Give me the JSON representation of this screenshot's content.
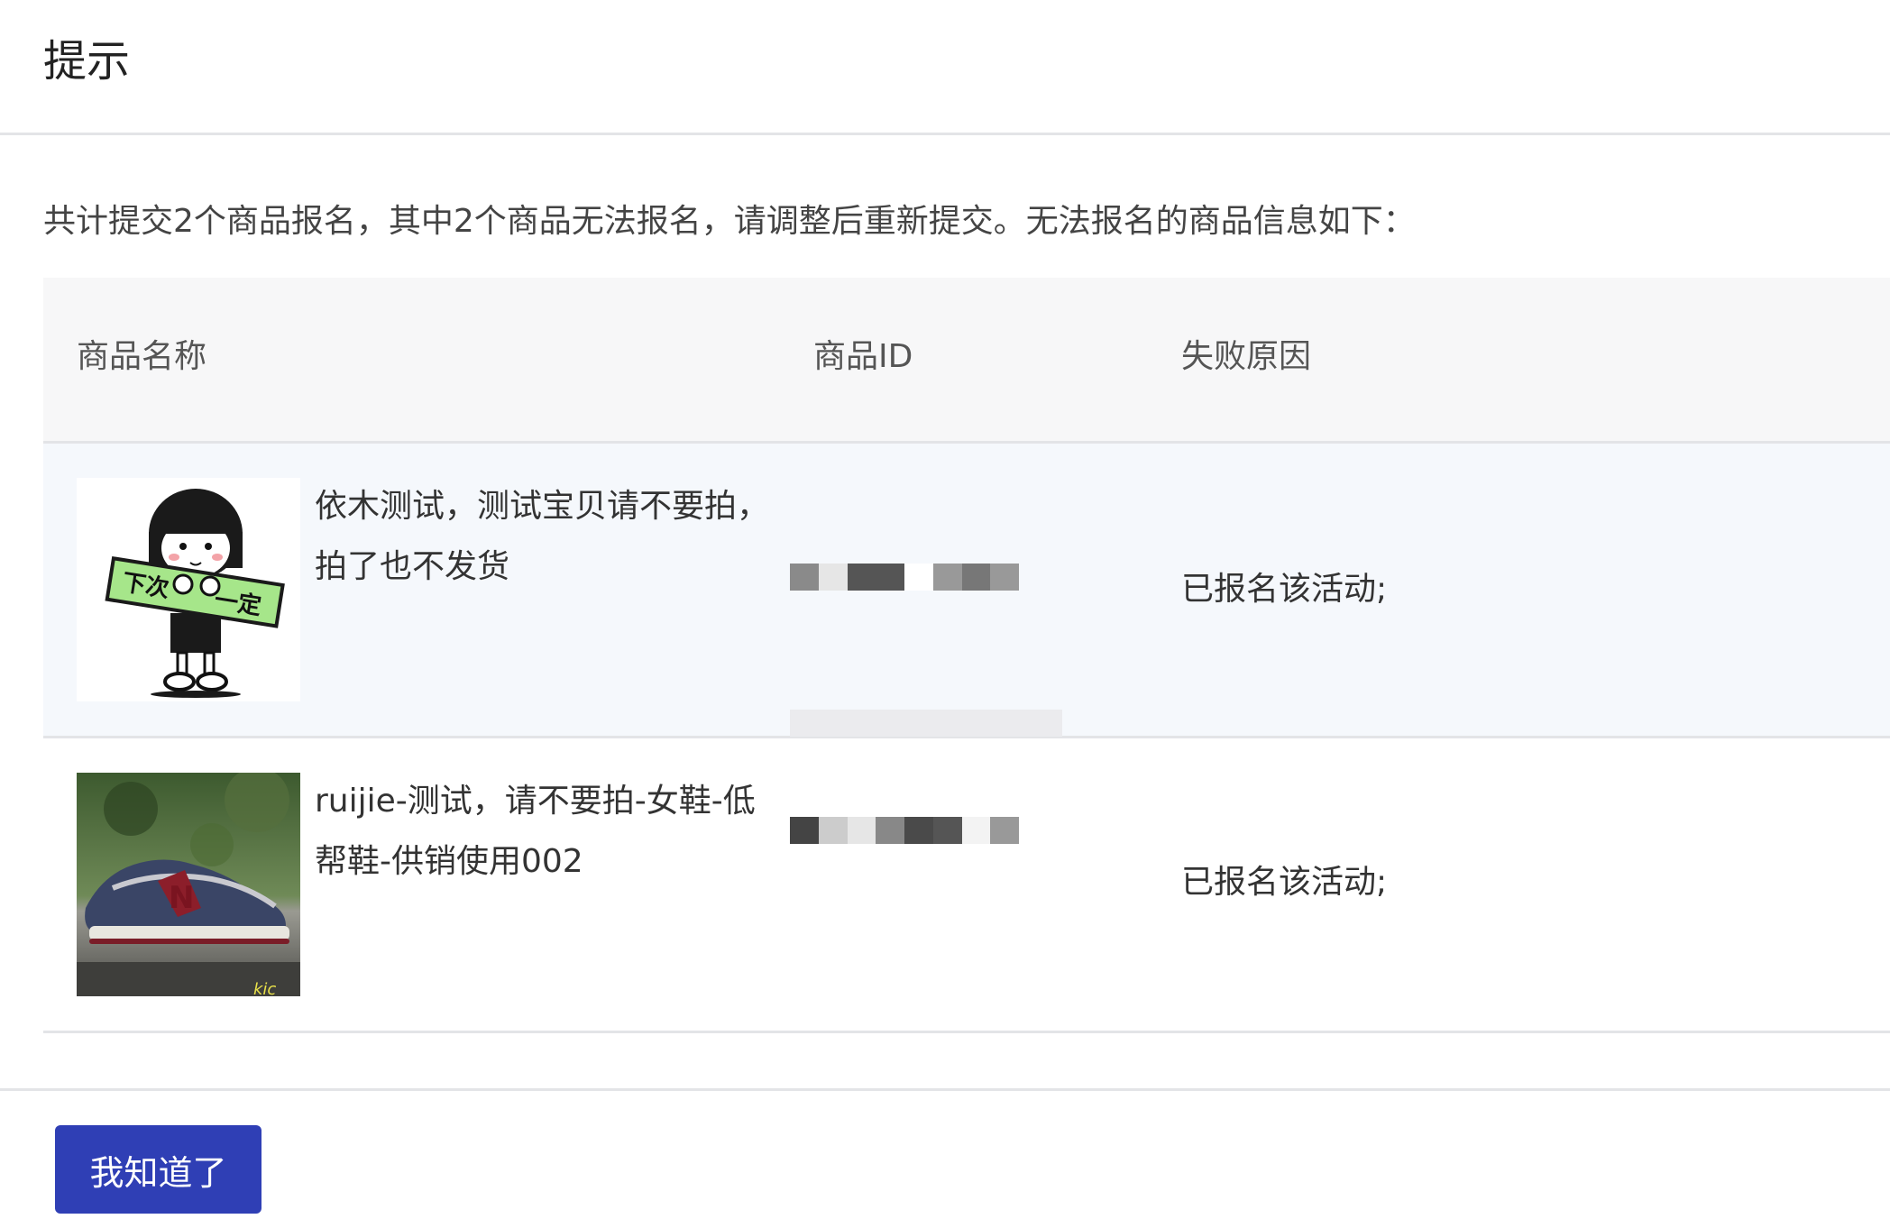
{
  "dialog": {
    "title": "提示",
    "summary": "共计提交2个商品报名，其中2个商品无法报名，请调整后重新提交。无法报名的商品信息如下："
  },
  "table": {
    "columns": [
      "商品名称",
      "商品ID",
      "失败原因"
    ],
    "rows": [
      {
        "name": "依木测试，测试宝贝请不要拍，拍了也不发货",
        "product_id": "",
        "reason": "已报名该活动;",
        "thumbnail_icon": "cartoon-girl-sign-image",
        "thumbnail_text": "下次一定"
      },
      {
        "name": "ruijie-测试，请不要拍-女鞋-低帮鞋-供销使用002",
        "product_id": "",
        "reason": "已报名该活动;",
        "thumbnail_icon": "sneaker-photo-image"
      }
    ]
  },
  "footer": {
    "confirm_label": "我知道了"
  },
  "colors": {
    "primary": "#2f3fb5",
    "header_bg": "#f7f7f8",
    "row_hover_bg": "#f5f8fc",
    "border": "#e3e4e7"
  }
}
